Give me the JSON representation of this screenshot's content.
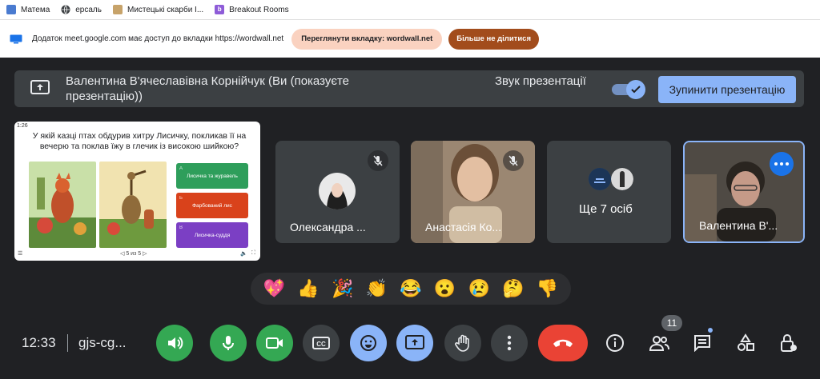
{
  "bookmarks": [
    {
      "label": "Матема",
      "icon": "image-icon",
      "color": "#4a7bd0"
    },
    {
      "label": "ерсаль",
      "icon": "globe-icon",
      "color": "#5f6368"
    },
    {
      "label": "Мистецькі скарби I...",
      "icon": "book-icon",
      "color": "#c7a36a"
    },
    {
      "label": "Breakout Rooms",
      "icon": "breakout-icon",
      "color": "#8e5cd8"
    }
  ],
  "infobar": {
    "message": "Додаток meet.google.com має доступ до вкладки https://wordwall.net",
    "view_tab": "Переглянути вкладку: wordwall.net",
    "stop_sharing": "Більше не ділитися"
  },
  "presenting": {
    "name": "Валентина В'ячеславівна Корнійчук (Ви (показуєте презентацію))",
    "sound_label": "Звук презентації",
    "sound_on": true,
    "stop_button": "Зупинити презентацію"
  },
  "slide": {
    "number": "1:26",
    "question": "У якій казці птах обдурив хитру Лисичку, покликав її на вечерю та поклав їжу в глечик із високою шийкою?",
    "answers": [
      {
        "letter": "A",
        "text": "Лисичка та журавель",
        "color": "#2e9e5b"
      },
      {
        "letter": "Б",
        "text": "Фарбований лис",
        "color": "#d9421b"
      },
      {
        "letter": "В",
        "text": "Лисичка-суддя",
        "color": "#7b3fc4"
      }
    ],
    "pager": "5 из 5"
  },
  "participants": [
    {
      "name": "Олександра ...",
      "muted": true
    },
    {
      "name": "Анастасія Ко...",
      "muted": true
    },
    {
      "name": "Ще 7 осіб"
    },
    {
      "name": "Валентина В'...",
      "active": true
    }
  ],
  "reactions": [
    "💖",
    "👍",
    "🎉",
    "👏",
    "😂",
    "😮",
    "😢",
    "🤔",
    "👎"
  ],
  "bottom": {
    "time": "12:33",
    "meeting_code": "gjs-cg...",
    "participants_count": "11"
  },
  "colors": {
    "accent": "#8ab4f8",
    "green": "#34a853",
    "red": "#ea4335",
    "tile": "#3c4043",
    "active_border": "#8ab4f8"
  }
}
